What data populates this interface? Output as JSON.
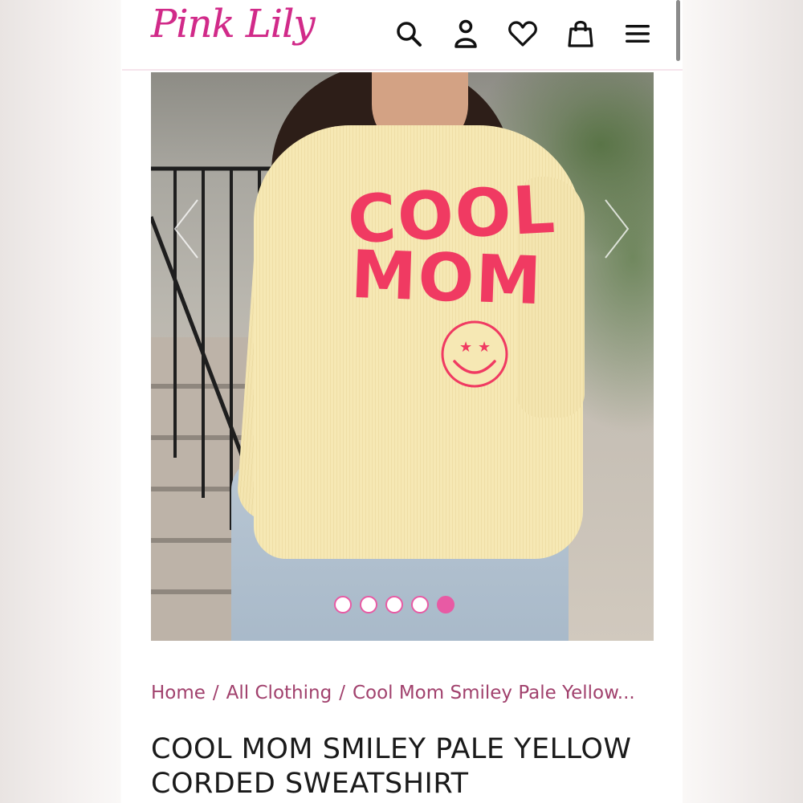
{
  "header": {
    "logo_text": "Pink Lily",
    "brand_color": "#d12a89",
    "icons": [
      "search-icon",
      "account-icon",
      "heart-icon",
      "bag-icon",
      "menu-icon"
    ]
  },
  "gallery": {
    "slide_count": 5,
    "active_slide": 5,
    "print_line1": "COOL",
    "print_line2": "MOM",
    "dot_color": "#e85aa4"
  },
  "breadcrumb": {
    "items": [
      "Home",
      "All Clothing",
      "Cool Mom Smiley Pale Yellow..."
    ],
    "separator": "/",
    "color": "#a1416d"
  },
  "product": {
    "title": "COOL MOM SMILEY PALE YELLOW CORDED SWEATSHIRT"
  }
}
